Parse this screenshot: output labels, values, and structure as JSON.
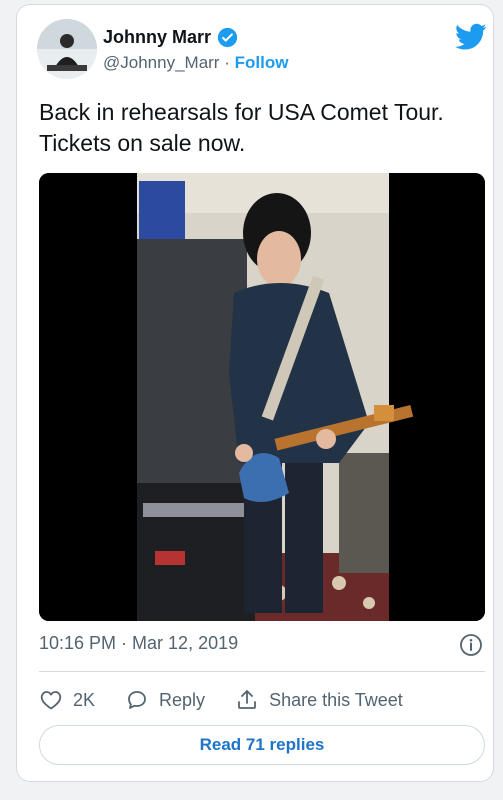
{
  "author": {
    "display_name": "Johnny Marr",
    "handle": "@Johnny_Marr",
    "separator": "·",
    "follow_label": "Follow",
    "verified": true
  },
  "tweet": {
    "text_line1": "Back in rehearsals for USA Comet Tour.",
    "text_line2": "Tickets on sale now.",
    "timestamp": "10:16 PM · Mar 12, 2019"
  },
  "actions": {
    "like_count": "2K",
    "reply_label": "Reply",
    "share_label": "Share this Tweet"
  },
  "read_replies_label": "Read 71 replies",
  "icons": [
    "avatar",
    "verified-badge-icon",
    "twitter-bird-icon",
    "info-icon",
    "heart-icon",
    "reply-icon",
    "share-icon"
  ],
  "colors": {
    "accent": "#1d9bf0",
    "text": "#0f1419",
    "muted": "#536471"
  }
}
